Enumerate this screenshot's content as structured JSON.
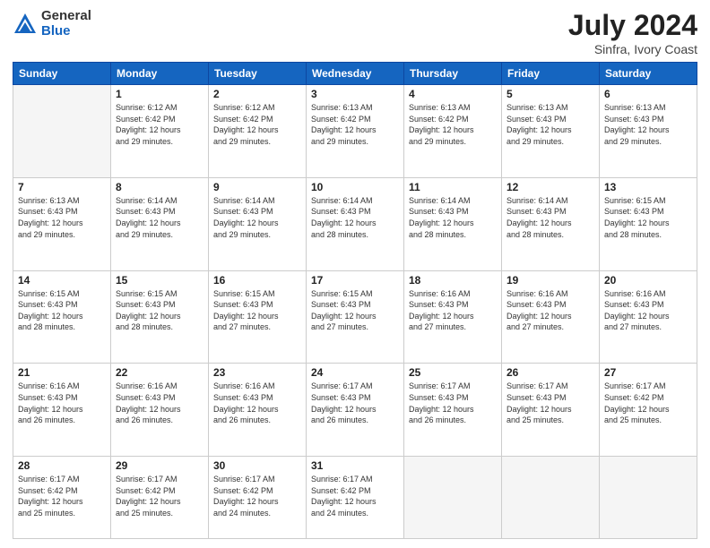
{
  "logo": {
    "general": "General",
    "blue": "Blue"
  },
  "title": {
    "month": "July 2024",
    "location": "Sinfra, Ivory Coast"
  },
  "weekdays": [
    "Sunday",
    "Monday",
    "Tuesday",
    "Wednesday",
    "Thursday",
    "Friday",
    "Saturday"
  ],
  "weeks": [
    [
      {
        "day": "",
        "info": ""
      },
      {
        "day": "1",
        "info": "Sunrise: 6:12 AM\nSunset: 6:42 PM\nDaylight: 12 hours\nand 29 minutes."
      },
      {
        "day": "2",
        "info": "Sunrise: 6:12 AM\nSunset: 6:42 PM\nDaylight: 12 hours\nand 29 minutes."
      },
      {
        "day": "3",
        "info": "Sunrise: 6:13 AM\nSunset: 6:42 PM\nDaylight: 12 hours\nand 29 minutes."
      },
      {
        "day": "4",
        "info": "Sunrise: 6:13 AM\nSunset: 6:42 PM\nDaylight: 12 hours\nand 29 minutes."
      },
      {
        "day": "5",
        "info": "Sunrise: 6:13 AM\nSunset: 6:43 PM\nDaylight: 12 hours\nand 29 minutes."
      },
      {
        "day": "6",
        "info": "Sunrise: 6:13 AM\nSunset: 6:43 PM\nDaylight: 12 hours\nand 29 minutes."
      }
    ],
    [
      {
        "day": "7",
        "info": ""
      },
      {
        "day": "8",
        "info": "Sunrise: 6:14 AM\nSunset: 6:43 PM\nDaylight: 12 hours\nand 29 minutes."
      },
      {
        "day": "9",
        "info": "Sunrise: 6:14 AM\nSunset: 6:43 PM\nDaylight: 12 hours\nand 29 minutes."
      },
      {
        "day": "10",
        "info": "Sunrise: 6:14 AM\nSunset: 6:43 PM\nDaylight: 12 hours\nand 28 minutes."
      },
      {
        "day": "11",
        "info": "Sunrise: 6:14 AM\nSunset: 6:43 PM\nDaylight: 12 hours\nand 28 minutes."
      },
      {
        "day": "12",
        "info": "Sunrise: 6:14 AM\nSunset: 6:43 PM\nDaylight: 12 hours\nand 28 minutes."
      },
      {
        "day": "13",
        "info": "Sunrise: 6:15 AM\nSunset: 6:43 PM\nDaylight: 12 hours\nand 28 minutes."
      }
    ],
    [
      {
        "day": "14",
        "info": ""
      },
      {
        "day": "15",
        "info": "Sunrise: 6:15 AM\nSunset: 6:43 PM\nDaylight: 12 hours\nand 28 minutes."
      },
      {
        "day": "16",
        "info": "Sunrise: 6:15 AM\nSunset: 6:43 PM\nDaylight: 12 hours\nand 27 minutes."
      },
      {
        "day": "17",
        "info": "Sunrise: 6:15 AM\nSunset: 6:43 PM\nDaylight: 12 hours\nand 27 minutes."
      },
      {
        "day": "18",
        "info": "Sunrise: 6:16 AM\nSunset: 6:43 PM\nDaylight: 12 hours\nand 27 minutes."
      },
      {
        "day": "19",
        "info": "Sunrise: 6:16 AM\nSunset: 6:43 PM\nDaylight: 12 hours\nand 27 minutes."
      },
      {
        "day": "20",
        "info": "Sunrise: 6:16 AM\nSunset: 6:43 PM\nDaylight: 12 hours\nand 27 minutes."
      }
    ],
    [
      {
        "day": "21",
        "info": ""
      },
      {
        "day": "22",
        "info": "Sunrise: 6:16 AM\nSunset: 6:43 PM\nDaylight: 12 hours\nand 26 minutes."
      },
      {
        "day": "23",
        "info": "Sunrise: 6:16 AM\nSunset: 6:43 PM\nDaylight: 12 hours\nand 26 minutes."
      },
      {
        "day": "24",
        "info": "Sunrise: 6:17 AM\nSunset: 6:43 PM\nDaylight: 12 hours\nand 26 minutes."
      },
      {
        "day": "25",
        "info": "Sunrise: 6:17 AM\nSunset: 6:43 PM\nDaylight: 12 hours\nand 26 minutes."
      },
      {
        "day": "26",
        "info": "Sunrise: 6:17 AM\nSunset: 6:43 PM\nDaylight: 12 hours\nand 25 minutes."
      },
      {
        "day": "27",
        "info": "Sunrise: 6:17 AM\nSunset: 6:42 PM\nDaylight: 12 hours\nand 25 minutes."
      }
    ],
    [
      {
        "day": "28",
        "info": "Sunrise: 6:17 AM\nSunset: 6:42 PM\nDaylight: 12 hours\nand 25 minutes."
      },
      {
        "day": "29",
        "info": "Sunrise: 6:17 AM\nSunset: 6:42 PM\nDaylight: 12 hours\nand 25 minutes."
      },
      {
        "day": "30",
        "info": "Sunrise: 6:17 AM\nSunset: 6:42 PM\nDaylight: 12 hours\nand 24 minutes."
      },
      {
        "day": "31",
        "info": "Sunrise: 6:17 AM\nSunset: 6:42 PM\nDaylight: 12 hours\nand 24 minutes."
      },
      {
        "day": "",
        "info": ""
      },
      {
        "day": "",
        "info": ""
      },
      {
        "day": "",
        "info": ""
      }
    ]
  ],
  "week1_sunday_info": "Sunrise: 6:13 AM\nSunset: 6:43 PM\nDaylight: 12 hours\nand 29 minutes.",
  "week2_sunday_info": "Sunrise: 6:13 AM\nSunset: 6:43 PM\nDaylight: 12 hours\nand 29 minutes.",
  "week3_sunday_info": "Sunrise: 6:15 AM\nSunset: 6:43 PM\nDaylight: 12 hours\nand 28 minutes.",
  "week4_sunday_info": "Sunrise: 6:16 AM\nSunset: 6:43 PM\nDaylight: 12 hours\nand 26 minutes."
}
